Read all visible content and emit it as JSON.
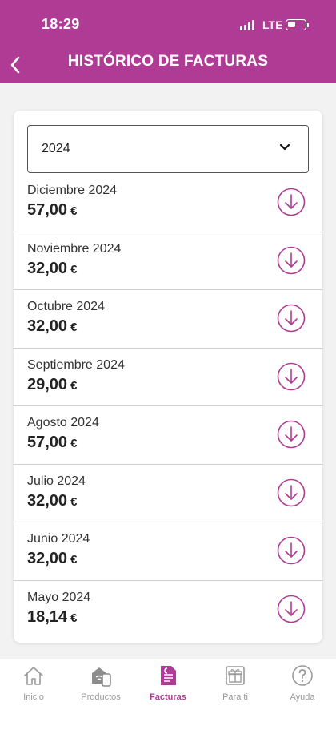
{
  "status_bar": {
    "time": "18:29",
    "network": "LTE"
  },
  "header": {
    "title": "HISTÓRICO DE FACTURAS",
    "back_icon": "chevron-left-icon"
  },
  "year_selector": {
    "value": "2024",
    "icon": "chevron-down-icon"
  },
  "invoices": [
    {
      "month": "Diciembre 2024",
      "amount": "57,00",
      "currency": "€"
    },
    {
      "month": "Noviembre 2024",
      "amount": "32,00",
      "currency": "€"
    },
    {
      "month": "Octubre 2024",
      "amount": "32,00",
      "currency": "€"
    },
    {
      "month": "Septiembre 2024",
      "amount": "29,00",
      "currency": "€"
    },
    {
      "month": "Agosto 2024",
      "amount": "57,00",
      "currency": "€"
    },
    {
      "month": "Julio 2024",
      "amount": "32,00",
      "currency": "€"
    },
    {
      "month": "Junio 2024",
      "amount": "32,00",
      "currency": "€"
    },
    {
      "month": "Mayo 2024",
      "amount": "18,14",
      "currency": "€"
    }
  ],
  "tabbar": {
    "items": [
      {
        "label": "Inicio",
        "icon": "home-icon"
      },
      {
        "label": "Productos",
        "icon": "devices-icon"
      },
      {
        "label": "Facturas",
        "icon": "invoice-icon",
        "active": true
      },
      {
        "label": "Para ti",
        "icon": "gift-icon"
      },
      {
        "label": "Ayuda",
        "icon": "help-icon"
      }
    ]
  },
  "colors": {
    "brand": "#b03b94",
    "inactive": "#9a9a9a",
    "background": "#f2f2f2"
  }
}
